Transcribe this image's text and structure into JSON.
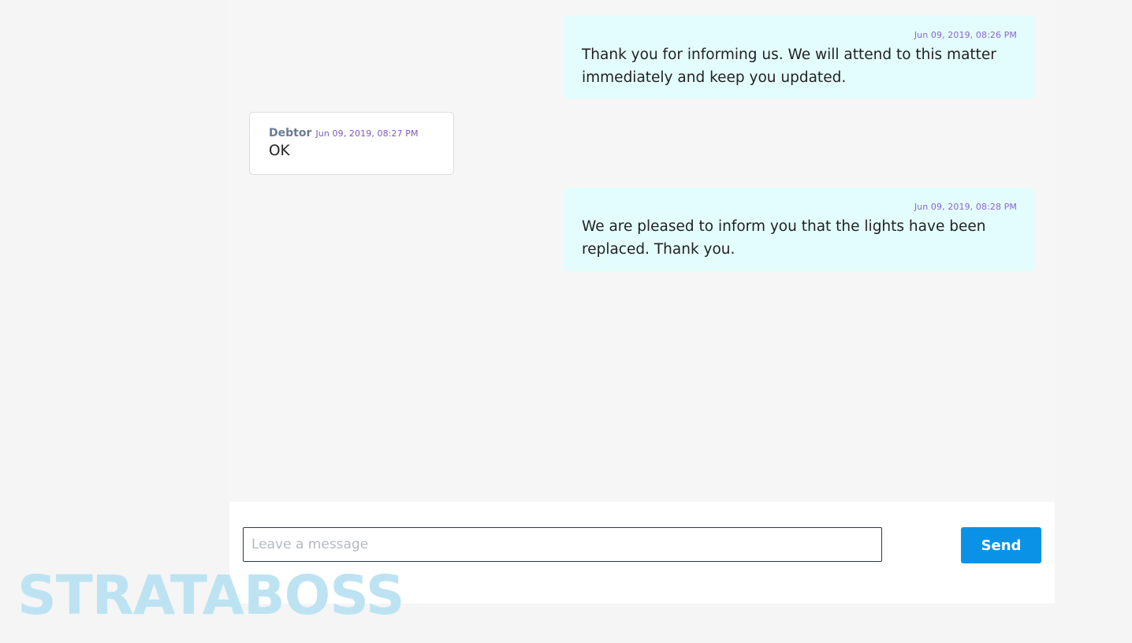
{
  "messages": [
    {
      "direction": "outgoing",
      "timestamp": "Jun 09, 2019, 08:26 PM",
      "text": "Thank you for informing us. We will attend to this matter immediately and keep you updated."
    },
    {
      "direction": "incoming",
      "sender": "Debtor",
      "timestamp": "Jun 09, 2019, 08:27 PM",
      "text": "OK"
    },
    {
      "direction": "outgoing",
      "timestamp": "Jun 09, 2019, 08:28 PM",
      "text": "We are pleased to inform you that the lights have been replaced. Thank you."
    }
  ],
  "composer": {
    "placeholder": "Leave a message",
    "value": "",
    "send_label": "Send"
  },
  "watermark": "STRATABOSS",
  "colors": {
    "outgoing_bubble": "#e3fdfd",
    "incoming_bubble": "#ffffff",
    "timestamp": "#7e57c2",
    "send_button": "#0a93e6",
    "watermark": "#bde3f2"
  }
}
